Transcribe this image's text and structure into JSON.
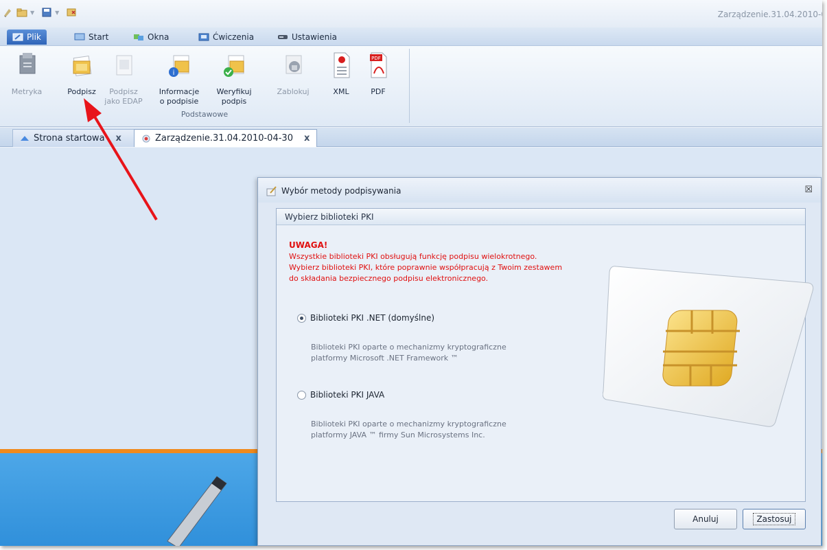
{
  "window": {
    "title": "Zarządzenie.31.04.2010-0"
  },
  "menu": {
    "tabs": [
      {
        "label": "Plik",
        "active": true
      },
      {
        "label": "Start"
      },
      {
        "label": "Okna"
      },
      {
        "label": "Ćwiczenia"
      },
      {
        "label": "Ustawienia"
      }
    ]
  },
  "ribbon": {
    "buttons": [
      {
        "line1": "Metryka",
        "line2": "",
        "enabled": false
      },
      {
        "line1": "Podpisz",
        "line2": "",
        "enabled": true
      },
      {
        "line1": "Podpisz",
        "line2": "jako EDAP",
        "enabled": false
      },
      {
        "line1": "Informacje",
        "line2": "o podpisie",
        "enabled": true
      },
      {
        "line1": "Weryfikuj",
        "line2": "podpis",
        "enabled": true
      },
      {
        "line1": "Zablokuj",
        "line2": "",
        "enabled": false
      },
      {
        "line1": "XML",
        "line2": "",
        "enabled": true
      },
      {
        "line1": "PDF",
        "line2": "",
        "enabled": true
      }
    ],
    "group_label": "Podstawowe",
    "pdf_badge": "PDF"
  },
  "doctabs": [
    {
      "label": "Strona startowa",
      "close": "x",
      "active": false
    },
    {
      "label": "Zarządzenie.31.04.2010-04-30",
      "close": "x",
      "active": true
    }
  ],
  "dialog": {
    "title": "Wybór metody podpisywania",
    "close": "☒",
    "panel_title": "Wybierz biblioteki PKI",
    "warning_title": "UWAGA!",
    "warning_lines": [
      "Wszystkie biblioteki PKI obsługują funkcję podpisu wielokrotnego.",
      "Wybierz biblioteki PKI, które poprawnie współpracują z Twoim zestawem",
      "do składania bezpiecznego podpisu elektronicznego."
    ],
    "options": [
      {
        "label": "Biblioteki PKI .NET (domyślne)",
        "checked": true,
        "desc1": "Biblioteki PKI oparte o mechanizmy kryptograficzne",
        "desc2": "platformy Microsoft .NET Framework ™"
      },
      {
        "label": "Biblioteki PKI JAVA",
        "checked": false,
        "desc1": "Biblioteki PKI oparte o mechanizmy kryptograficzne",
        "desc2": "platformy JAVA ™ firmy Sun Microsystems Inc."
      }
    ],
    "cancel_label": "Anuluj",
    "apply_label": "Zastosuj"
  },
  "colors": {
    "warning": "#e01010",
    "accent_tab": "#2f64b8",
    "orange": "#f08a1c",
    "annotation_arrow": "#e8141a"
  }
}
